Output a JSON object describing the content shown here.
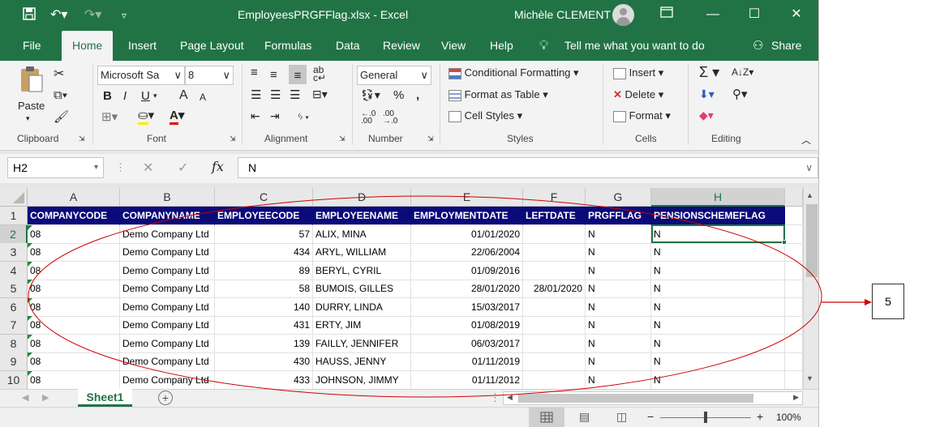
{
  "window": {
    "title": "EmployeesPRGFFlag.xlsx  -  Excel",
    "user": "Michèle CLEMENT"
  },
  "tabs": [
    "File",
    "Home",
    "Insert",
    "Page Layout",
    "Formulas",
    "Data",
    "Review",
    "View",
    "Help"
  ],
  "tell_me": "Tell me what you want to do",
  "share": "Share",
  "ribbon": {
    "clipboard": {
      "paste": "Paste",
      "label": "Clipboard"
    },
    "font": {
      "name": "Microsoft Sa",
      "size": "8",
      "bold": "B",
      "italic": "I",
      "underline": "U",
      "grow": "A",
      "shrink": "A",
      "fontcolor": "A",
      "label": "Font"
    },
    "alignment": {
      "label": "Alignment"
    },
    "number": {
      "format": "General",
      "label": "Number"
    },
    "styles": {
      "conditional": "Conditional Formatting",
      "format_table": "Format as Table",
      "cell_styles": "Cell Styles",
      "label": "Styles"
    },
    "cells": {
      "insert": "Insert",
      "delete": "Delete",
      "format": "Format",
      "label": "Cells"
    },
    "editing": {
      "label": "Editing"
    }
  },
  "formula_bar": {
    "name_box": "H2",
    "fx": "fx",
    "value": "N"
  },
  "columns": [
    "A",
    "B",
    "C",
    "D",
    "E",
    "F",
    "G",
    "H"
  ],
  "rows": [
    [
      "COMPANYCODE",
      "COMPANYNAME",
      "EMPLOYEECODE",
      "EMPLOYEENAME",
      "EMPLOYMENTDATE",
      "LEFTDATE",
      "PRGFFLAG",
      "PENSIONSCHEMEFLAG"
    ],
    [
      "08",
      "Demo Company Ltd",
      "57",
      "ALIX, MINA",
      "01/01/2020",
      "",
      "N",
      "N"
    ],
    [
      "08",
      "Demo Company Ltd",
      "434",
      "ARYL, WILLIAM",
      "22/06/2004",
      "",
      "N",
      "N"
    ],
    [
      "08",
      "Demo Company Ltd",
      "89",
      "BERYL, CYRIL",
      "01/09/2016",
      "",
      "N",
      "N"
    ],
    [
      "08",
      "Demo Company Ltd",
      "58",
      "BUMOIS, GILLES",
      "28/01/2020",
      "28/01/2020",
      "N",
      "N"
    ],
    [
      "08",
      "Demo Company Ltd",
      "140",
      "DURRY, LINDA",
      "15/03/2017",
      "",
      "N",
      "N"
    ],
    [
      "08",
      "Demo Company Ltd",
      "431",
      "ERTY, JIM",
      "01/08/2019",
      "",
      "N",
      "N"
    ],
    [
      "08",
      "Demo Company Ltd",
      "139",
      "FAILLY, JENNIFER",
      "06/03/2017",
      "",
      "N",
      "N"
    ],
    [
      "08",
      "Demo Company Ltd",
      "430",
      "HAUSS, JENNY",
      "01/11/2019",
      "",
      "N",
      "N"
    ],
    [
      "08",
      "Demo Company Ltd",
      "433",
      "JOHNSON, JIMMY",
      "01/11/2012",
      "",
      "N",
      "N"
    ]
  ],
  "row_numbers": [
    "1",
    "2",
    "3",
    "4",
    "5",
    "6",
    "7",
    "8",
    "9",
    "10"
  ],
  "sheet_tab": "Sheet1",
  "zoom": "100%",
  "annotation": "5",
  "colors": {
    "brand": "#217346",
    "header_fill": "#0a0a7a",
    "annotation": "#cc0000"
  }
}
